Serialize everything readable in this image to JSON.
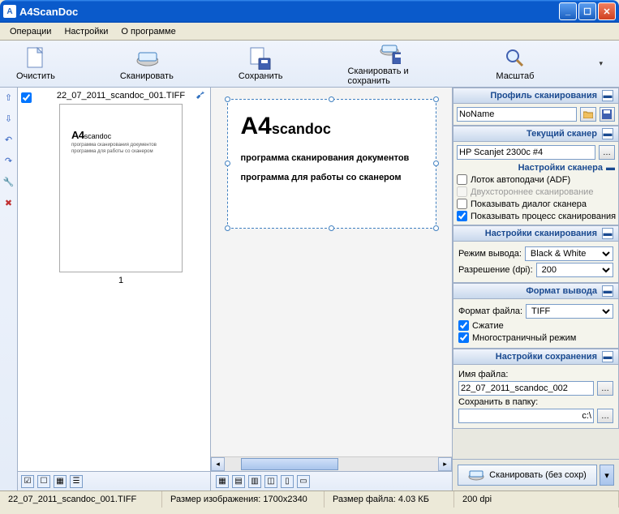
{
  "window": {
    "title": "A4ScanDoc"
  },
  "menu": {
    "operations": "Операции",
    "settings": "Настройки",
    "about": "О программе"
  },
  "toolbar": {
    "clear": "Очистить",
    "scan": "Сканировать",
    "save": "Сохранить",
    "scan_save": "Сканировать и сохранить",
    "zoom": "Масштаб"
  },
  "thumbnail": {
    "filename": "22_07_2011_scandoc_001.TIFF",
    "page_number": "1",
    "logo_big": "A4",
    "logo_small": "scandoc",
    "sub1": "программа сканирования документов",
    "sub2": "программа для работы со сканером"
  },
  "preview": {
    "logo_big": "A4",
    "logo_small": "scandoc",
    "line1": "программа сканирования  документов",
    "line2": "программа для работы со сканером"
  },
  "right": {
    "profile_header": "Профиль сканирования",
    "profile_name": "NoName",
    "scanner_header": "Текущий сканер",
    "scanner_name": "HP Scanjet 2300c #4",
    "scanner_settings_header": "Настройки сканера",
    "adf": "Лоток автоподачи (ADF)",
    "duplex": "Двухстороннее сканирование",
    "show_dialog": "Показывать диалог сканера",
    "show_process": "Показывать процесс сканирования",
    "scan_settings_header": "Настройки сканирования",
    "output_mode_label": "Режим вывода:",
    "output_mode": "Black & White",
    "dpi_label": "Разрешение (dpi):",
    "dpi": "200",
    "format_header": "Формат вывода",
    "file_format_label": "Формат файла:",
    "file_format": "TIFF",
    "compression": "Сжатие",
    "multipage": "Многостраничный режим",
    "save_header": "Настройки сохранения",
    "filename_label": "Имя файла:",
    "filename_value": "22_07_2011_scandoc_002",
    "folder_label": "Сохранить в папку:",
    "folder_value": "c:\\",
    "scan_nosave": "Сканировать (без сохр)"
  },
  "status": {
    "file": "22_07_2011_scandoc_001.TIFF",
    "size_img_label": "Размер изображения:",
    "size_img": "1700x2340",
    "size_file_label": "Размер файла:",
    "size_file": "4.03 КБ",
    "dpi": "200 dpi"
  }
}
